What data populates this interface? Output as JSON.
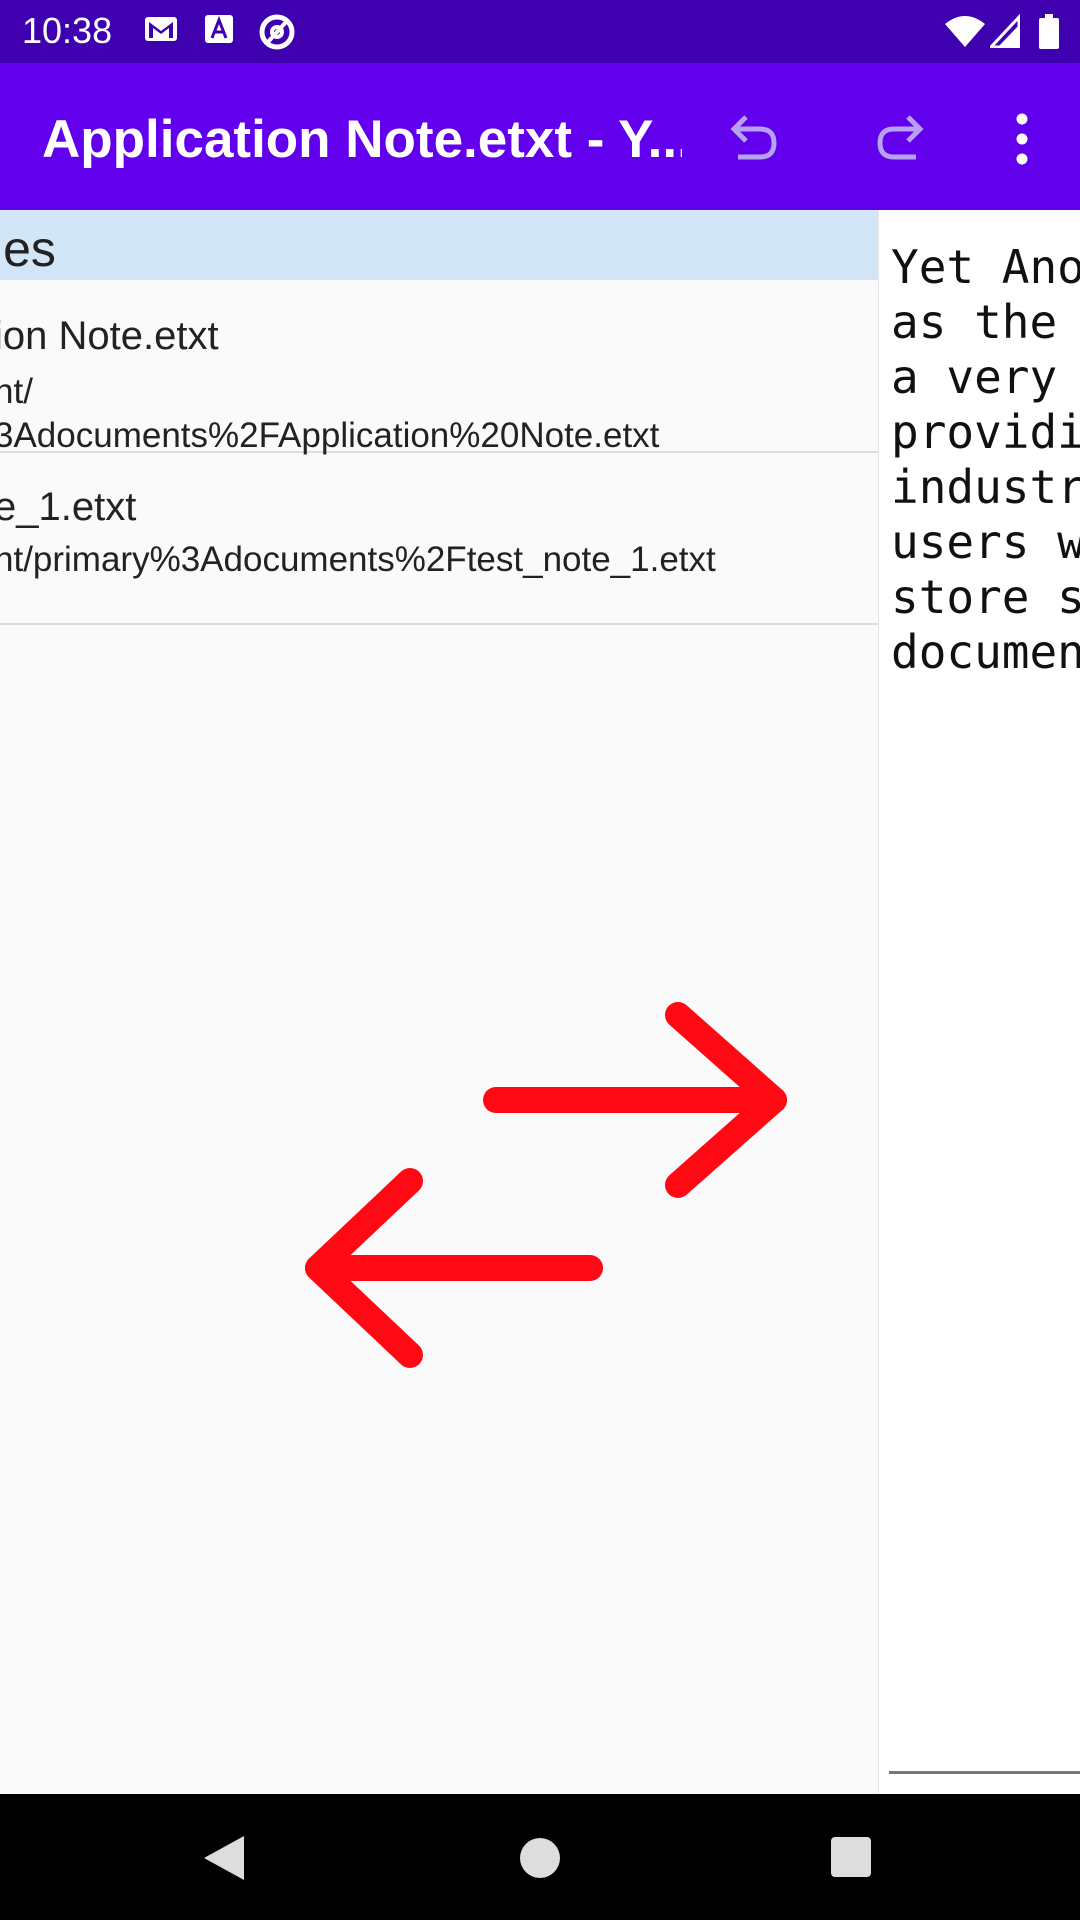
{
  "status_bar": {
    "time": "10:38",
    "icons": [
      "gmail-icon",
      "text-recognition-icon",
      "at-sign-icon",
      "wifi-icon",
      "signal-icon",
      "battery-icon"
    ]
  },
  "app_bar": {
    "title": "Application Note.etxt - Y...",
    "actions": [
      "undo-icon",
      "redo-icon",
      "more-options-icon"
    ],
    "color": "#6200ee"
  },
  "files_panel": {
    "header": "les",
    "items": [
      {
        "name": "ion Note.etxt",
        "path_lines": [
          "nt/",
          "3Adocuments%2FApplication%20Note.etxt"
        ]
      },
      {
        "name": "e_1.etxt",
        "path_lines": [
          "nt/primary%3Adocuments%2Ftest_note_1.etxt"
        ]
      }
    ]
  },
  "editor": {
    "text": "Yet Ano\nas the \na very \nprovidi\nindustr\nusers w\nstore s\ndocumen"
  },
  "overlay": {
    "icon": "swap-arrows-icon",
    "color": "#ff0a14"
  },
  "nav_bar": {
    "buttons": [
      "back-icon",
      "home-icon",
      "recents-icon"
    ]
  }
}
